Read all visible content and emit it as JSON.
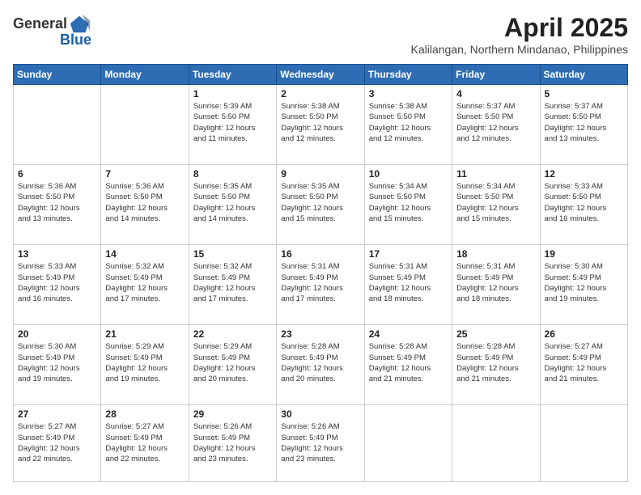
{
  "logo": {
    "line1": "General",
    "line2": "Blue"
  },
  "title": "April 2025",
  "location": "Kalilangan, Northern Mindanao, Philippines",
  "days_header": [
    "Sunday",
    "Monday",
    "Tuesday",
    "Wednesday",
    "Thursday",
    "Friday",
    "Saturday"
  ],
  "weeks": [
    [
      {
        "day": "",
        "info": ""
      },
      {
        "day": "",
        "info": ""
      },
      {
        "day": "1",
        "info": "Sunrise: 5:39 AM\nSunset: 5:50 PM\nDaylight: 12 hours\nand 11 minutes."
      },
      {
        "day": "2",
        "info": "Sunrise: 5:38 AM\nSunset: 5:50 PM\nDaylight: 12 hours\nand 12 minutes."
      },
      {
        "day": "3",
        "info": "Sunrise: 5:38 AM\nSunset: 5:50 PM\nDaylight: 12 hours\nand 12 minutes."
      },
      {
        "day": "4",
        "info": "Sunrise: 5:37 AM\nSunset: 5:50 PM\nDaylight: 12 hours\nand 12 minutes."
      },
      {
        "day": "5",
        "info": "Sunrise: 5:37 AM\nSunset: 5:50 PM\nDaylight: 12 hours\nand 13 minutes."
      }
    ],
    [
      {
        "day": "6",
        "info": "Sunrise: 5:36 AM\nSunset: 5:50 PM\nDaylight: 12 hours\nand 13 minutes."
      },
      {
        "day": "7",
        "info": "Sunrise: 5:36 AM\nSunset: 5:50 PM\nDaylight: 12 hours\nand 14 minutes."
      },
      {
        "day": "8",
        "info": "Sunrise: 5:35 AM\nSunset: 5:50 PM\nDaylight: 12 hours\nand 14 minutes."
      },
      {
        "day": "9",
        "info": "Sunrise: 5:35 AM\nSunset: 5:50 PM\nDaylight: 12 hours\nand 15 minutes."
      },
      {
        "day": "10",
        "info": "Sunrise: 5:34 AM\nSunset: 5:50 PM\nDaylight: 12 hours\nand 15 minutes."
      },
      {
        "day": "11",
        "info": "Sunrise: 5:34 AM\nSunset: 5:50 PM\nDaylight: 12 hours\nand 15 minutes."
      },
      {
        "day": "12",
        "info": "Sunrise: 5:33 AM\nSunset: 5:50 PM\nDaylight: 12 hours\nand 16 minutes."
      }
    ],
    [
      {
        "day": "13",
        "info": "Sunrise: 5:33 AM\nSunset: 5:49 PM\nDaylight: 12 hours\nand 16 minutes."
      },
      {
        "day": "14",
        "info": "Sunrise: 5:32 AM\nSunset: 5:49 PM\nDaylight: 12 hours\nand 17 minutes."
      },
      {
        "day": "15",
        "info": "Sunrise: 5:32 AM\nSunset: 5:49 PM\nDaylight: 12 hours\nand 17 minutes."
      },
      {
        "day": "16",
        "info": "Sunrise: 5:31 AM\nSunset: 5:49 PM\nDaylight: 12 hours\nand 17 minutes."
      },
      {
        "day": "17",
        "info": "Sunrise: 5:31 AM\nSunset: 5:49 PM\nDaylight: 12 hours\nand 18 minutes."
      },
      {
        "day": "18",
        "info": "Sunrise: 5:31 AM\nSunset: 5:49 PM\nDaylight: 12 hours\nand 18 minutes."
      },
      {
        "day": "19",
        "info": "Sunrise: 5:30 AM\nSunset: 5:49 PM\nDaylight: 12 hours\nand 19 minutes."
      }
    ],
    [
      {
        "day": "20",
        "info": "Sunrise: 5:30 AM\nSunset: 5:49 PM\nDaylight: 12 hours\nand 19 minutes."
      },
      {
        "day": "21",
        "info": "Sunrise: 5:29 AM\nSunset: 5:49 PM\nDaylight: 12 hours\nand 19 minutes."
      },
      {
        "day": "22",
        "info": "Sunrise: 5:29 AM\nSunset: 5:49 PM\nDaylight: 12 hours\nand 20 minutes."
      },
      {
        "day": "23",
        "info": "Sunrise: 5:28 AM\nSunset: 5:49 PM\nDaylight: 12 hours\nand 20 minutes."
      },
      {
        "day": "24",
        "info": "Sunrise: 5:28 AM\nSunset: 5:49 PM\nDaylight: 12 hours\nand 21 minutes."
      },
      {
        "day": "25",
        "info": "Sunrise: 5:28 AM\nSunset: 5:49 PM\nDaylight: 12 hours\nand 21 minutes."
      },
      {
        "day": "26",
        "info": "Sunrise: 5:27 AM\nSunset: 5:49 PM\nDaylight: 12 hours\nand 21 minutes."
      }
    ],
    [
      {
        "day": "27",
        "info": "Sunrise: 5:27 AM\nSunset: 5:49 PM\nDaylight: 12 hours\nand 22 minutes."
      },
      {
        "day": "28",
        "info": "Sunrise: 5:27 AM\nSunset: 5:49 PM\nDaylight: 12 hours\nand 22 minutes."
      },
      {
        "day": "29",
        "info": "Sunrise: 5:26 AM\nSunset: 5:49 PM\nDaylight: 12 hours\nand 23 minutes."
      },
      {
        "day": "30",
        "info": "Sunrise: 5:26 AM\nSunset: 5:49 PM\nDaylight: 12 hours\nand 23 minutes."
      },
      {
        "day": "",
        "info": ""
      },
      {
        "day": "",
        "info": ""
      },
      {
        "day": "",
        "info": ""
      }
    ]
  ]
}
